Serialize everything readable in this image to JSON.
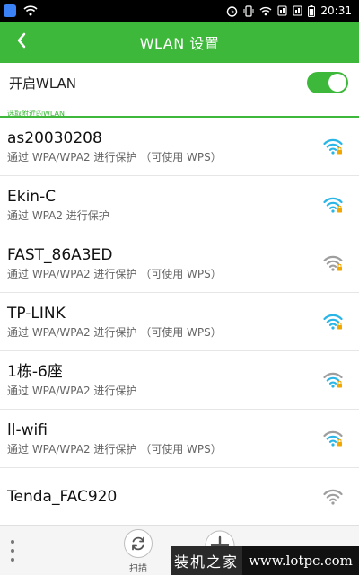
{
  "status_bar": {
    "time": "20:31"
  },
  "header": {
    "title": "WLAN 设置",
    "back_icon": "chevron-left-icon"
  },
  "wlan_toggle": {
    "label": "开启WLAN",
    "state": "on"
  },
  "section": {
    "label": "选取附近的WLAN"
  },
  "networks": [
    {
      "name": "as20030208",
      "security": "通过 WPA/WPA2 进行保护 （可使用 WPS）",
      "locked": true
    },
    {
      "name": "Ekin-C",
      "security": "通过 WPA2 进行保护",
      "locked": true
    },
    {
      "name": "FAST_86A3ED",
      "security": "通过 WPA/WPA2 进行保护 （可使用 WPS）",
      "locked": true
    },
    {
      "name": "TP-LINK",
      "security": "通过 WPA/WPA2 进行保护 （可使用 WPS）",
      "locked": true
    },
    {
      "name": "1栋-6座",
      "security": "通过 WPA/WPA2 进行保护",
      "locked": true
    },
    {
      "name": "ll-wifi",
      "security": "通过 WPA/WPA2 进行保护 （可使用 WPS）",
      "locked": true
    },
    {
      "name": "Tenda_FAC920",
      "security": "",
      "locked": false
    }
  ],
  "bottom_bar": {
    "scan_label": "扫描"
  },
  "watermark": {
    "logo_text": "装机之家",
    "url": "www.lotpc.com"
  },
  "colors": {
    "accent": "#3db83a",
    "wifi_strong": "#29b6e6",
    "wifi_weak": "#9e9e9e",
    "lock": "#f0a800"
  }
}
